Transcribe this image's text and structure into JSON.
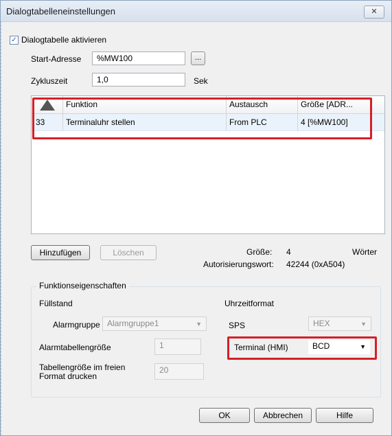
{
  "window": {
    "title": "Dialogtabelleneinstellungen",
    "close_symbol": "✕"
  },
  "enable": {
    "label": "Dialogtabelle aktivieren",
    "checked": true,
    "check_symbol": "✓"
  },
  "start_address": {
    "label": "Start-Adresse",
    "value": "%MW100",
    "browse_label": "..."
  },
  "cycle_time": {
    "label": "Zykluszeit",
    "value": "1,0",
    "unit": "Sek"
  },
  "table": {
    "sort_icon": "sort-triangle-icon",
    "columns": [
      "Funktion",
      "Austausch",
      "Größe [ADR..."
    ],
    "rows": [
      {
        "id": "33",
        "function": "Terminaluhr stellen",
        "exchange": "From PLC",
        "size": "4 [%MW100]"
      }
    ]
  },
  "buttons": {
    "add": "Hinzufügen",
    "delete": "Löschen",
    "ok": "OK",
    "cancel": "Abbrechen",
    "help": "Hilfe"
  },
  "info": {
    "size_label": "Größe:",
    "size_value": "4",
    "size_unit": "Wörter",
    "auth_label": "Autorisierungswort:",
    "auth_value": "42244 (0xA504)"
  },
  "properties": {
    "caption": "Funktionseigenschaften",
    "fill_level": "Füllstand",
    "alarm_group_label": "Alarmgruppe",
    "alarm_group_value": "Alarmgruppe1",
    "alarm_table_size_label": "Alarmtabellengröße",
    "alarm_table_size_value": "1",
    "table_size_label_line1": "Tabellengröße im freien",
    "table_size_label_line2": "Format drucken",
    "table_size_value": "20",
    "time_format": "Uhrzeitformat",
    "sps_label": "SPS",
    "sps_value": "HEX",
    "terminal_label": "Terminal (HMI)",
    "terminal_value": "BCD"
  },
  "colors": {
    "highlight": "#d61f26",
    "selection": "#eaf3fb"
  }
}
